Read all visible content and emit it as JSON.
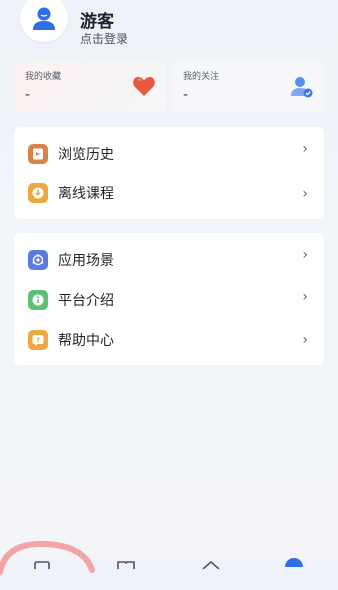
{
  "profile": {
    "name": "游客",
    "login_text": "点击登录",
    "avatar_icon": "user-avatar-icon"
  },
  "stats": [
    {
      "label": "我的收藏",
      "value": "-",
      "icon": "heart-icon",
      "icon_color": "#e8573f"
    },
    {
      "label": "我的关注",
      "value": "-",
      "icon": "user-follow-icon",
      "icon_color": "#3f76e6"
    }
  ],
  "menu_groups": [
    {
      "items": [
        {
          "label": "浏览历史",
          "icon": "history-icon",
          "icon_color": "#d9834b",
          "arrow": "›"
        },
        {
          "label": "离线课程",
          "icon": "download-icon",
          "icon_color": "#efa741",
          "arrow": "›"
        }
      ]
    },
    {
      "items": [
        {
          "label": "应用场景",
          "icon": "scene-icon",
          "icon_color": "#5b7be0",
          "arrow": "›"
        },
        {
          "label": "平台介绍",
          "icon": "info-icon",
          "icon_color": "#5fbf74",
          "arrow": "›"
        },
        {
          "label": "帮助中心",
          "icon": "help-icon",
          "icon_color": "#efa741",
          "arrow": "›"
        }
      ]
    }
  ],
  "bottom_nav": {
    "items": [
      "home-icon",
      "book-icon",
      "house-icon",
      "profile-icon"
    ],
    "active_color": "#2f6fe6",
    "highlight_color": "#f5a3a3"
  }
}
